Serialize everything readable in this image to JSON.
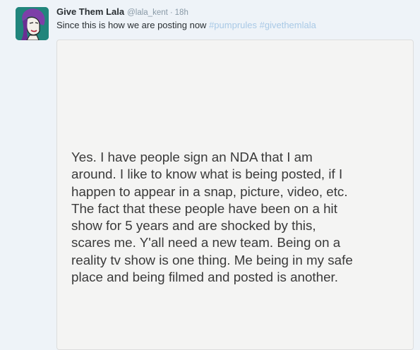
{
  "tweet": {
    "author": {
      "display_name": "Give Them Lala",
      "handle": "@lala_kent",
      "avatar_icon": "profile-avatar-purple-hair"
    },
    "separator": "·",
    "time": "18h",
    "text": "Since this is how we are posting now",
    "hashtags": [
      "#pumprules",
      "#givethemlala"
    ],
    "media": {
      "note_lines": [
        "Yes. I have people sign an NDA that I am",
        "around. I like to know what is being posted, if I",
        "happen to appear in a snap, picture, video, etc.",
        "The fact that these people have been on a hit",
        "show for 5 years and are shocked by this,",
        "scares me. Y'all need a new team. Being on a",
        "reality tv show is one thing. Me being in my safe",
        "place and being filmed and posted is another."
      ]
    }
  },
  "colors": {
    "background": "#eef3f8",
    "name": "#292f33",
    "meta": "#8899a6",
    "hashtag": "#a9c9e6",
    "note_bg": "#f4f4f3"
  }
}
